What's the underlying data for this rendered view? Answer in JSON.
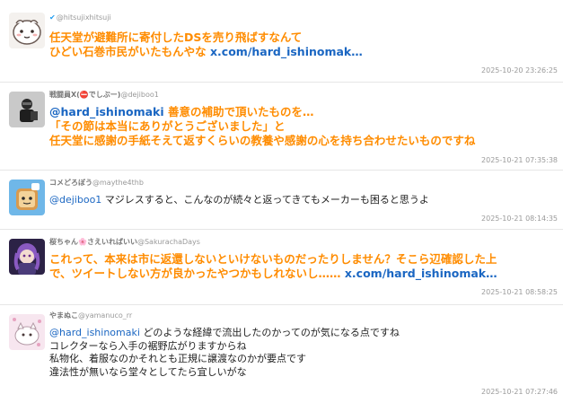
{
  "tweets": [
    {
      "verified_mark": "✔",
      "display_name": "",
      "username": "@hitsujixhitsuji",
      "lines": [
        "任天堂が避難所に寄付したDSを売り飛ばすなんて",
        "ひどい石巻市民がいたもんやな "
      ],
      "link": "x.com/hard_ishinomak…",
      "timestamp": "2025-10-20 23:26:25"
    },
    {
      "display_name": "戦闘員X(⛔でしぶー)",
      "username": "@dejiboo1",
      "mention": "@hard_ishinomaki",
      "lines": [
        " 善意の補助で頂いたものを…",
        "「その節は本当にありがとうございました」と",
        "任天堂に感謝の手紙そえて返すくらいの教養や感謝の心を持ち合わせたいものですね"
      ],
      "timestamp": "2025-10-21 07:35:38"
    },
    {
      "display_name": "コメどろぼう",
      "username": "@maythe4thb",
      "mention": "@dejiboo1",
      "lines": [
        " マジレスすると、こんなのが続々と返ってきてもメーカーも困ると思うよ"
      ],
      "timestamp": "2025-10-21 08:14:35"
    },
    {
      "display_name": "桜ちゃん🌸さえいればいい",
      "username": "@SakurachaDays",
      "lines": [
        "これって、本来は市に返還しないといけないものだったりしません？そこら辺確認した上",
        "で、ツイートしない方が良かったやつかもしれないし…… "
      ],
      "link": "x.com/hard_ishinomak…",
      "timestamp": "2025-10-21 08:58:25"
    },
    {
      "display_name": "やまぬこ",
      "username": "@yamanuco_rr",
      "mention": "@hard_ishinomaki",
      "lines": [
        " どのような経緯で流出したのかってのが気になる点ですね",
        "コレクターなら入手の裾野広がりますからね",
        "私物化、着服なのかそれとも正規に譲渡なのかが要点です",
        "違法性が無いなら堂々としてたら宜しいがな"
      ],
      "timestamp": "2025-10-21 07:27:46"
    }
  ],
  "action_icons": [
    "↩",
    "⇄",
    "♡",
    "☆"
  ],
  "icon_names": [
    "reply-icon",
    "retweet-icon",
    "like-icon",
    "bookmark-icon"
  ]
}
